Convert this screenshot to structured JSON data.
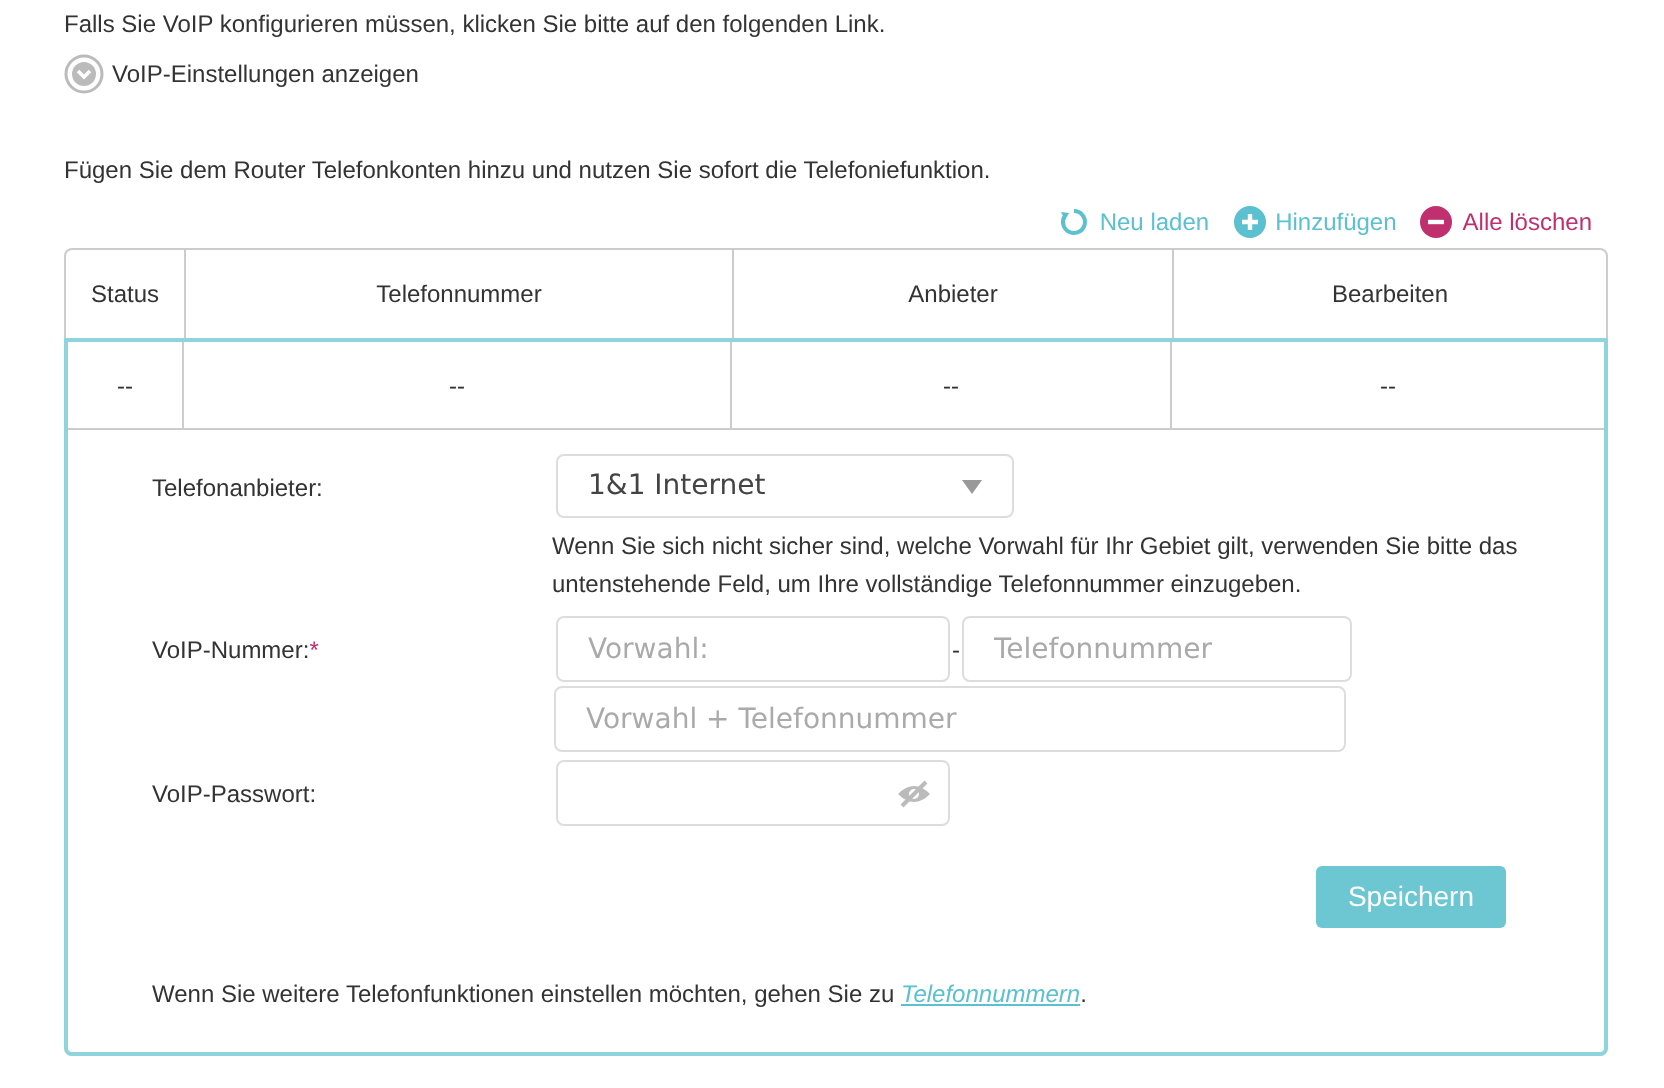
{
  "intro": "Falls Sie VoIP konfigurieren müssen, klicken Sie bitte auf den folgenden Link.",
  "voip_settings_link": {
    "label": "VoIP-Einstellungen anzeigen",
    "expanded": false
  },
  "description": "Fügen Sie dem Router Telefonkonten hinzu und nutzen Sie sofort die Telefoniefunktion.",
  "actions": [
    {
      "kind": "reload",
      "label": "Neu laden"
    },
    {
      "kind": "add",
      "label": "Hinzufügen"
    },
    {
      "kind": "delete",
      "label": "Alle löschen"
    }
  ],
  "table": {
    "columns": [
      "Status",
      "Telefonnummer",
      "Anbieter",
      "Bearbeiten"
    ],
    "rows": [
      [
        "--",
        "--",
        "--",
        "--"
      ]
    ]
  },
  "form": {
    "provider": {
      "label": "Telefonanbieter:",
      "value": "1&1 Internet"
    },
    "hint": "Wenn Sie sich nicht sicher sind, welche Vorwahl für Ihr Gebiet gilt, verwenden Sie bitte das untenstehende Feld, um Ihre vollständige Telefonnummer einzugeben.",
    "number": {
      "label": "VoIP-Nummer:",
      "required_mark": "*",
      "area_code_placeholder": "Vorwahl:",
      "separator": "-",
      "number_placeholder": "Telefonnummer",
      "full_placeholder": "Vorwahl + Telefonnummer"
    },
    "password": {
      "label": "VoIP-Passwort:",
      "visible": false
    },
    "save_button": "Speichern",
    "footer": {
      "text": "Wenn Sie weitere Telefonfunktionen einstellen möchten, gehen Sie zu ",
      "link": "Telefonnummern",
      "suffix": "."
    }
  }
}
